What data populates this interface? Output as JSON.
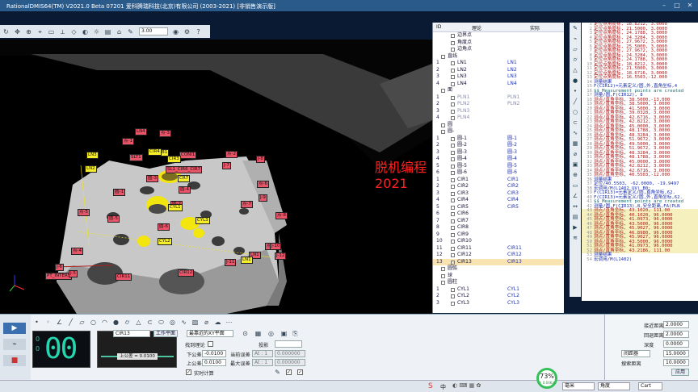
{
  "window": {
    "title": "RationalDMIS64(TM) V2021.0 Beta 07201   爱科腾瑞科技(北京)有限公司 (2003-2021) [非销售演示版]"
  },
  "toolbar": {
    "zoom_value": "3.00"
  },
  "viewport": {
    "watermark": "脱机编程2021",
    "red_labels": [
      "LN4",
      "点-3",
      "点-1",
      "点-2",
      "圆-3",
      "圆-4",
      "圆-1",
      "圆-2",
      "圆-5",
      "圆-6",
      "点-8",
      "点-7",
      "点-6",
      "点-5",
      "点-4",
      "点-9",
      "PT_INTERS",
      "J-5",
      "J-6",
      "J-7",
      "J-8",
      "J-9",
      "J-10",
      "J-11",
      "J-12",
      "CIR11",
      "CIR12",
      "SL1_CIR6_CIR7",
      "SLT1",
      "CONI1",
      "LN1"
    ],
    "yellow_labels": [
      "LN3",
      "LN2",
      "CIR3",
      "CYL1",
      "CYL2",
      "CYL3",
      "CR7",
      "B1",
      "CIR4",
      "LN1"
    ]
  },
  "tree": {
    "headers": [
      "ID",
      "理论",
      "实际"
    ],
    "rows": [
      {
        "id": "",
        "name": "边界点",
        "act": "",
        "type": "leaf"
      },
      {
        "id": "",
        "name": "角度点",
        "act": "",
        "type": "leaf"
      },
      {
        "id": "",
        "name": "边角点",
        "act": "",
        "type": "leaf"
      },
      {
        "id": "",
        "name": "直线",
        "act": "",
        "type": "group"
      },
      {
        "id": "1",
        "name": "LN1",
        "act": "LN1",
        "type": "item"
      },
      {
        "id": "2",
        "name": "LN2",
        "act": "LN2",
        "type": "item"
      },
      {
        "id": "3",
        "name": "LN3",
        "act": "LN3",
        "type": "item"
      },
      {
        "id": "4",
        "name": "LN4",
        "act": "LN4",
        "type": "item"
      },
      {
        "id": "",
        "name": "面",
        "act": "",
        "type": "group"
      },
      {
        "id": "1",
        "name": "PLN1",
        "act": "PLN1",
        "type": "dim"
      },
      {
        "id": "2",
        "name": "PLN2",
        "act": "PLN2",
        "type": "dim"
      },
      {
        "id": "3",
        "name": "PLN3",
        "act": "",
        "type": "dim"
      },
      {
        "id": "4",
        "name": "PLN4",
        "act": "",
        "type": "dim"
      },
      {
        "id": "",
        "name": "圆",
        "act": "",
        "type": "group"
      },
      {
        "id": "",
        "name": "圆-",
        "act": "",
        "type": "group"
      },
      {
        "id": "1",
        "name": "圆-1",
        "act": "圆-1",
        "type": "item"
      },
      {
        "id": "2",
        "name": "圆-2",
        "act": "圆-2",
        "type": "item"
      },
      {
        "id": "3",
        "name": "圆-3",
        "act": "圆-3",
        "type": "item"
      },
      {
        "id": "4",
        "name": "圆-4",
        "act": "圆-4",
        "type": "item"
      },
      {
        "id": "5",
        "name": "圆-5",
        "act": "圆-5",
        "type": "item"
      },
      {
        "id": "6",
        "name": "圆-6",
        "act": "圆-6",
        "type": "item"
      },
      {
        "id": "1",
        "name": "CIR1",
        "act": "CIR1",
        "type": "item"
      },
      {
        "id": "2",
        "name": "CIR2",
        "act": "CIR2",
        "type": "item"
      },
      {
        "id": "3",
        "name": "CIR3",
        "act": "CIR3",
        "type": "item"
      },
      {
        "id": "4",
        "name": "CIR4",
        "act": "CIR4",
        "type": "item"
      },
      {
        "id": "5",
        "name": "CIR5",
        "act": "CIR5",
        "type": "item"
      },
      {
        "id": "6",
        "name": "CIR6",
        "act": "",
        "type": "item"
      },
      {
        "id": "7",
        "name": "CIR7",
        "act": "",
        "type": "item"
      },
      {
        "id": "8",
        "name": "CIR8",
        "act": "",
        "type": "item"
      },
      {
        "id": "9",
        "name": "CIR9",
        "act": "",
        "type": "item"
      },
      {
        "id": "10",
        "name": "CIR10",
        "act": "",
        "type": "item"
      },
      {
        "id": "11",
        "name": "CIR11",
        "act": "CIR11",
        "type": "item"
      },
      {
        "id": "12",
        "name": "CIR12",
        "act": "CIR12",
        "type": "item"
      },
      {
        "id": "13",
        "name": "CIR13",
        "act": "CIR13",
        "type": "sel"
      },
      {
        "id": "",
        "name": "圆弧",
        "act": "",
        "type": "group"
      },
      {
        "id": "",
        "name": "球",
        "act": "",
        "type": "group"
      },
      {
        "id": "",
        "name": "圆柱",
        "act": "",
        "type": "group"
      },
      {
        "id": "1",
        "name": "CYL1",
        "act": "CYL1",
        "type": "item"
      },
      {
        "id": "2",
        "name": "CYL2",
        "act": "CYL2",
        "type": "item"
      },
      {
        "id": "3",
        "name": "CYL3",
        "act": "CYL3",
        "type": "item"
      }
    ]
  },
  "code": {
    "lines": [
      {
        "n": "1",
        "t": "定位点角度标,    18.8212, 3.0000",
        "c": "red"
      },
      {
        "n": "2",
        "t": "定位点角度标,    21.5000, 3.0000",
        "c": "red"
      },
      {
        "n": "3",
        "t": "定位点角度标,    24.1788, 3.0000",
        "c": "red"
      },
      {
        "n": "4",
        "t": "定位点角度标,    24.3284, 3.0000",
        "c": "red"
      },
      {
        "n": "5",
        "t": "定位点角度标,    27.9672, 3.0000",
        "c": "red"
      },
      {
        "n": "6",
        "t": "定位点角度标,    25.5000, 3.0000",
        "c": "red"
      },
      {
        "n": "7",
        "t": "定位点角度标,    27.9672, 3.0000",
        "c": "red"
      },
      {
        "n": "8",
        "t": "定位点角度标,    24.3284, 3.0000",
        "c": "red"
      },
      {
        "n": "9",
        "t": "定位点角度标,    24.1788, 3.0000",
        "c": "red"
      },
      {
        "n": "10",
        "t": "定位点角度标,    18.8212, 3.0000",
        "c": "red"
      },
      {
        "n": "11",
        "t": "定位点角度标,    21.5000, 3.0000",
        "c": "red"
      },
      {
        "n": "12",
        "t": "定位点角度标,    18.6716, 3.0000",
        "c": "red"
      },
      {
        "n": "13",
        "t": "定位点角度标,    16.5503,-12.000",
        "c": "red"
      },
      {
        "n": "14",
        "t": "测量结果",
        "c": "blue"
      },
      {
        "n": "15",
        "t": "F(CIR12)=元素定义/圆,外,直角坐标,4",
        "c": "blue"
      },
      {
        "n": "16",
        "t": "$$ Measurement points are created",
        "c": "teal"
      },
      {
        "n": "17",
        "t": "测量/圆,F(CIR12), 8",
        "c": "blue"
      },
      {
        "n": "18",
        "t": "  测点/直角坐标,    38.5000,-13.000",
        "c": "red"
      },
      {
        "n": "19",
        "t": "  测点/直角坐标,    38.5000, 3.0000",
        "c": "red"
      },
      {
        "n": "20",
        "t": "  测点/直角坐标,    41.5000, 3.0000",
        "c": "red"
      },
      {
        "n": "21",
        "t": "  测点/直角坐标,    39.0328, 3.0000",
        "c": "red"
      },
      {
        "n": "22",
        "t": "  测点/直角坐标,    42.6716, 3.0000",
        "c": "red"
      },
      {
        "n": "23",
        "t": "  测点/直角坐标,    42.8212, 3.0000",
        "c": "red"
      },
      {
        "n": "24",
        "t": "  测点/直角坐标,    45.0000, 3.0000",
        "c": "red"
      },
      {
        "n": "25",
        "t": "  测点/直角坐标,    48.1788, 3.0000",
        "c": "red"
      },
      {
        "n": "26",
        "t": "  测点/直角坐标,    48.3284, 3.0000",
        "c": "red"
      },
      {
        "n": "27",
        "t": "  测点/直角坐标,    51.9672, 3.0000",
        "c": "red"
      },
      {
        "n": "28",
        "t": "  测点/直角坐标,    49.5000, 3.0000",
        "c": "red"
      },
      {
        "n": "29",
        "t": "  测点/直角坐标,    51.9672, 3.0000",
        "c": "red"
      },
      {
        "n": "30",
        "t": "  测点/直角坐标,    48.3284, 3.0000",
        "c": "red"
      },
      {
        "n": "31",
        "t": "  测点/直角坐标,    48.1788, 3.0000",
        "c": "red"
      },
      {
        "n": "32",
        "t": "  测点/直角坐标,    45.0000, 3.0000",
        "c": "red"
      },
      {
        "n": "33",
        "t": "  测点/直角坐标,    42.8212, 3.0000",
        "c": "red"
      },
      {
        "n": "34",
        "t": "  测点/直角坐标,    42.6716, 3.0000",
        "c": "red"
      },
      {
        "n": "35",
        "t": "  测点/直角坐标,    40.5503,-12.000",
        "c": "red"
      },
      {
        "n": "36",
        "t": "测量结果",
        "c": "blue"
      },
      {
        "n": "37",
        "t": "定位/40.5503, -62.0000, -19.9497",
        "c": "blue"
      },
      {
        "n": "38",
        "t": "宏调用/M(L1402_UV) B0;",
        "c": "blue"
      },
      {
        "n": "39",
        "t": "F(CIR13)=元素定义/圆,直角坐标,62.",
        "c": "blue"
      },
      {
        "n": "40",
        "t": "F(CIR13)=元素定义/圆,外,直角坐标,62.",
        "c": "blue"
      },
      {
        "n": "41",
        "t": "$$ Measurement points are created",
        "c": "teal"
      },
      {
        "n": "42",
        "t": "测量/圆,F(CIR13),8,安全距离,FA(PLN",
        "c": "blue"
      },
      {
        "n": "43",
        "t": "  测点/直角坐标,    43.1020, 111.00",
        "c": "red"
      },
      {
        "n": "44",
        "t": "  测点/直角坐标,    40.1020,  96.0000",
        "c": "red"
      },
      {
        "n": "45",
        "t": "  测点/直角坐标,    41.0973,  96.0000",
        "c": "red"
      },
      {
        "n": "46",
        "t": "  测点/直角坐标,    43.5000,  96.0000",
        "c": "red"
      },
      {
        "n": "47",
        "t": "  测点/直角坐标,    45.9027,  96.0000",
        "c": "red"
      },
      {
        "n": "48",
        "t": "  测点/直角坐标,    46.8980,  96.0000",
        "c": "red"
      },
      {
        "n": "49",
        "t": "  测点/直角坐标,    45.9027,  96.0000",
        "c": "red"
      },
      {
        "n": "50",
        "t": "  测点/直角坐标,    43.5000,  96.0000",
        "c": "red"
      },
      {
        "n": "51",
        "t": "  测点/直角坐标,    41.0973,  96.0000",
        "c": "red"
      },
      {
        "n": "52",
        "t": "  测点/直角坐标,    43.2186, 111.00",
        "c": "red"
      },
      {
        "n": "53",
        "t": "测量结果",
        "c": "blue"
      },
      {
        "n": "54",
        "t": "宏调用/M(L1402)",
        "c": "blue"
      }
    ]
  },
  "bottom": {
    "counter_value": "00",
    "counter_side_a": "0",
    "counter_side_b": "0",
    "tol_tag": "上公差 = 0.0100",
    "name_label": "名称",
    "name_value": "CIR13",
    "workplane_button": "工作平面",
    "plane_select": "最靠近的XY平面",
    "find_label": "找到理论",
    "proj_label": "投影",
    "lower_tol_label": "下公差",
    "lower_tol_value": "-0.0100",
    "upper_tol_label": "上公差",
    "upper_tol_value": "0.0100",
    "cur_err_label": "当前误差",
    "max_err_label": "最大误差",
    "cur_err_at": "At : 1",
    "cur_err_value": "0.000000",
    "max_err_at": "At : 1",
    "max_err_value": "0.000000",
    "realtime_label": "实时计算"
  },
  "right_panel": {
    "approach_label": "接近距离",
    "approach_value": "2.0000",
    "retract_label": "回退距离",
    "retract_value": "2.0000",
    "depth_label": "深度",
    "depth_value": "0.0000",
    "cycle_select": "间距器",
    "cycle_value": "15.0000",
    "search_label": "搜索距离",
    "search_value": "10.0000",
    "apply_button": "应用"
  },
  "status": {
    "unit": "毫米",
    "angle": "角度",
    "coord": "Cart",
    "gauge_pct": "73%",
    "gauge_speed": "↑ 0.04K/s"
  }
}
